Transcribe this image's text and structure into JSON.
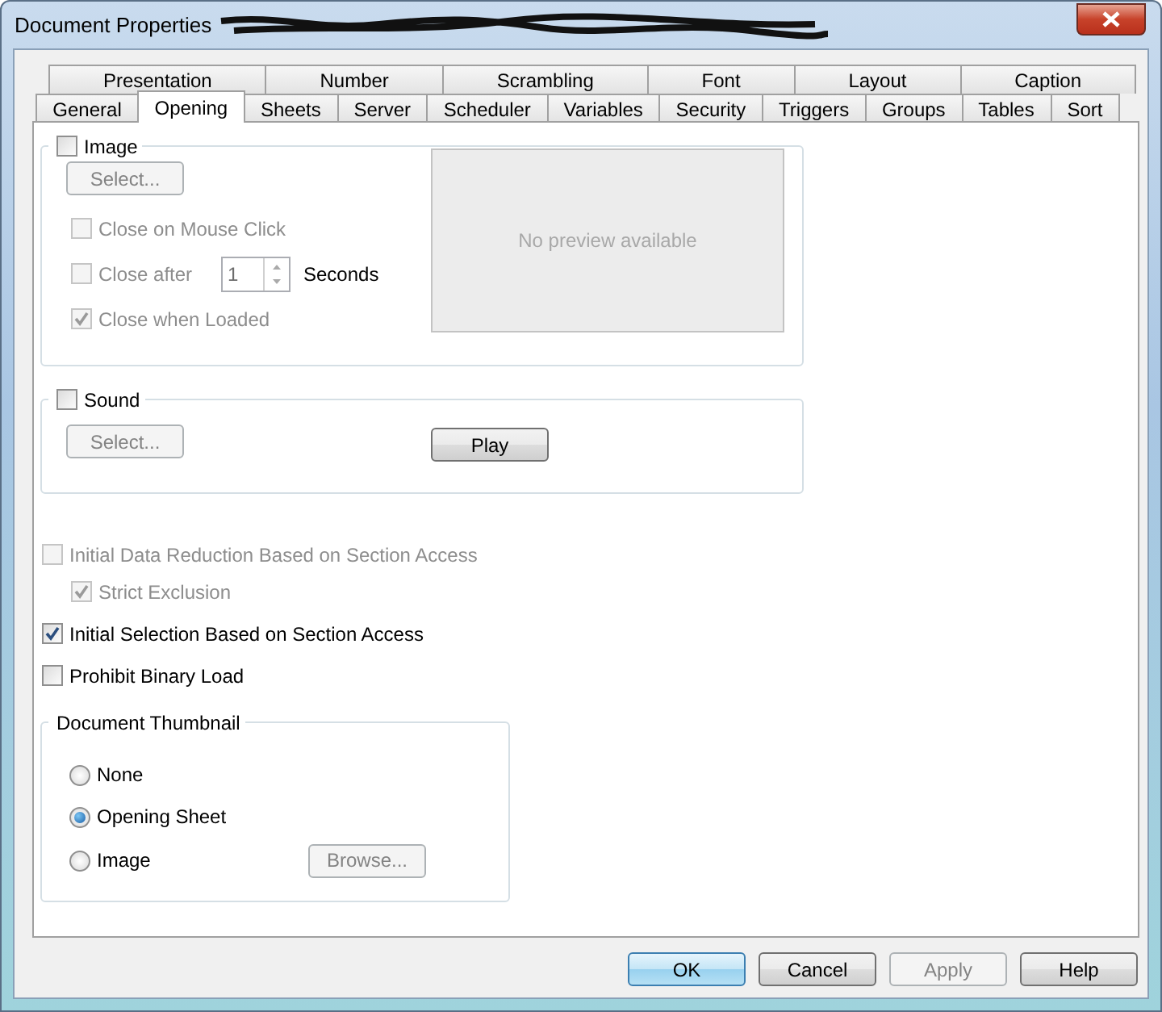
{
  "window": {
    "title": "Document Properties",
    "title_redacted": true
  },
  "tabs_row_1": [
    {
      "label": "Presentation",
      "selected": false
    },
    {
      "label": "Number",
      "selected": false
    },
    {
      "label": "Scrambling",
      "selected": false
    },
    {
      "label": "Font",
      "selected": false
    },
    {
      "label": "Layout",
      "selected": false
    },
    {
      "label": "Caption",
      "selected": false
    }
  ],
  "tabs_row_2": [
    {
      "label": "General",
      "selected": false
    },
    {
      "label": "Opening",
      "selected": true
    },
    {
      "label": "Sheets",
      "selected": false
    },
    {
      "label": "Server",
      "selected": false
    },
    {
      "label": "Scheduler",
      "selected": false
    },
    {
      "label": "Variables",
      "selected": false
    },
    {
      "label": "Security",
      "selected": false
    },
    {
      "label": "Triggers",
      "selected": false
    },
    {
      "label": "Groups",
      "selected": false
    },
    {
      "label": "Tables",
      "selected": false
    },
    {
      "label": "Sort",
      "selected": false
    }
  ],
  "image_group": {
    "label": "Image",
    "checked": false,
    "select_button": {
      "label": "Select...",
      "disabled": true
    },
    "options": [
      {
        "kind": "check",
        "label": "Close on Mouse Click",
        "checked": false,
        "disabled": true
      },
      {
        "kind": "spin",
        "label": "Close after",
        "checked": false,
        "disabled": true,
        "value": "1",
        "unit": "Seconds"
      },
      {
        "kind": "check",
        "label": "Close when Loaded",
        "checked": true,
        "disabled": true
      }
    ],
    "preview_text": "No preview available"
  },
  "sound_group": {
    "label": "Sound",
    "checked": false,
    "select_button": {
      "label": "Select...",
      "disabled": true
    },
    "play_button": {
      "label": "Play",
      "disabled": false
    }
  },
  "access_options": [
    {
      "label": "Initial Data Reduction Based on Section Access",
      "checked": false,
      "disabled": true,
      "children": [
        {
          "label": "Strict Exclusion",
          "checked": true,
          "disabled": true
        }
      ]
    },
    {
      "label": "Initial Selection Based on Section Access",
      "checked": true,
      "disabled": false
    },
    {
      "label": "Prohibit Binary Load",
      "checked": false,
      "disabled": false
    }
  ],
  "thumbnail_group": {
    "label": "Document Thumbnail",
    "options": [
      {
        "label": "None",
        "selected": false
      },
      {
        "label": "Opening Sheet",
        "selected": true
      },
      {
        "label": "Image",
        "selected": false
      }
    ],
    "browse_button": {
      "label": "Browse...",
      "disabled": true
    }
  },
  "buttons": [
    {
      "label": "OK",
      "kind": "default",
      "disabled": false
    },
    {
      "label": "Cancel",
      "kind": "normal",
      "disabled": false
    },
    {
      "label": "Apply",
      "kind": "normal",
      "disabled": true
    },
    {
      "label": "Help",
      "kind": "normal",
      "disabled": false
    }
  ]
}
